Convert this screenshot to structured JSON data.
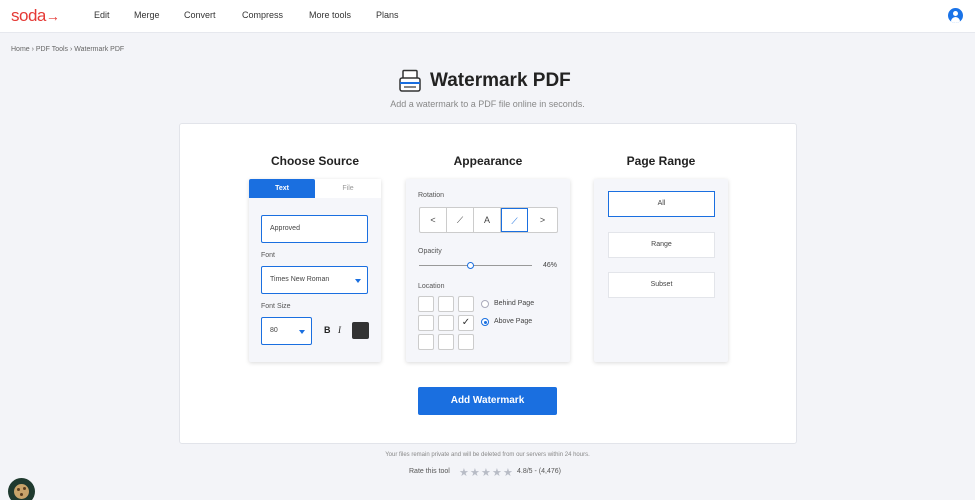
{
  "brand": {
    "name": "soda",
    "arrow": "→",
    "color": "#e53935"
  },
  "nav": [
    "Edit",
    "Merge",
    "Convert",
    "Compress",
    "More tools",
    "Plans"
  ],
  "breadcrumb": "Home › PDF Tools › Watermark PDF",
  "hero": {
    "title": "Watermark PDF",
    "subtitle": "Add a watermark to a PDF file online in seconds."
  },
  "source": {
    "title": "Choose Source",
    "tabs": [
      "Text",
      "File"
    ],
    "text_value": "Approved",
    "font_label": "Font",
    "font_value": "Times New Roman",
    "size_label": "Font Size",
    "size_value": "80",
    "bold": "B",
    "italic": "I",
    "color": "#333333"
  },
  "appearance": {
    "title": "Appearance",
    "rotation_label": "Rotation",
    "rotation_options": [
      "<",
      "⟋",
      "A",
      "⟋",
      ">"
    ],
    "opacity_label": "Opacity",
    "opacity_value": "46%",
    "opacity_fraction": 0.46,
    "location_label": "Location",
    "location_checkmark": "✓",
    "radio_behind": "Behind Page",
    "radio_above": "Above Page"
  },
  "range": {
    "title": "Page Range",
    "options": [
      "All",
      "Range",
      "Subset"
    ]
  },
  "cta": "Add Watermark",
  "privacy": "Your files remain private and will be deleted from our servers within 24 hours.",
  "rating": {
    "label": "Rate this tool",
    "value": "4.8/5 - (4,476)",
    "stars": "★"
  },
  "accent_color": "#1a6fe0"
}
